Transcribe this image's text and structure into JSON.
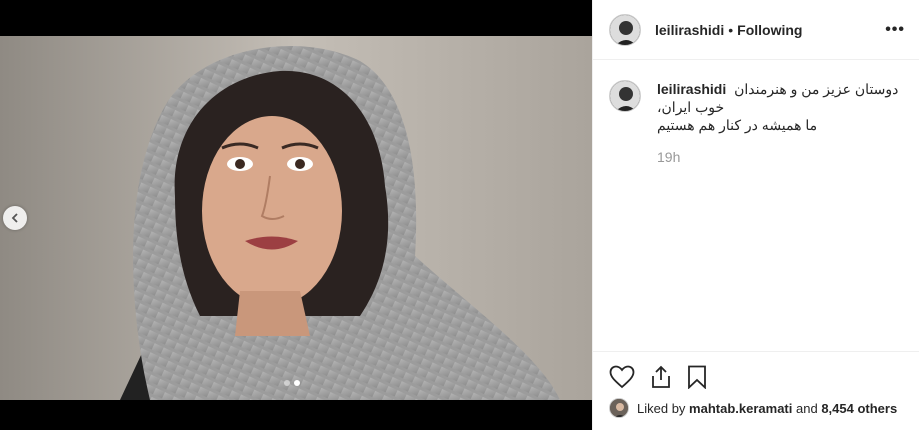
{
  "post": {
    "username": "leilirashidi",
    "separator": "•",
    "follow_status": "Following",
    "more_label": "•••"
  },
  "caption": {
    "username": "leilirashidi",
    "line1": "دوستان عزیز من و هنرمندان خوب ایران،",
    "line2": "ما همیشه در کنار هم هستیم",
    "time": "19h"
  },
  "likes": {
    "prefix": "Liked by",
    "user": "mahtab.keramati",
    "and": "and",
    "count": "8,454 others"
  },
  "carousel": {
    "slides": 2,
    "active_index": 1
  }
}
